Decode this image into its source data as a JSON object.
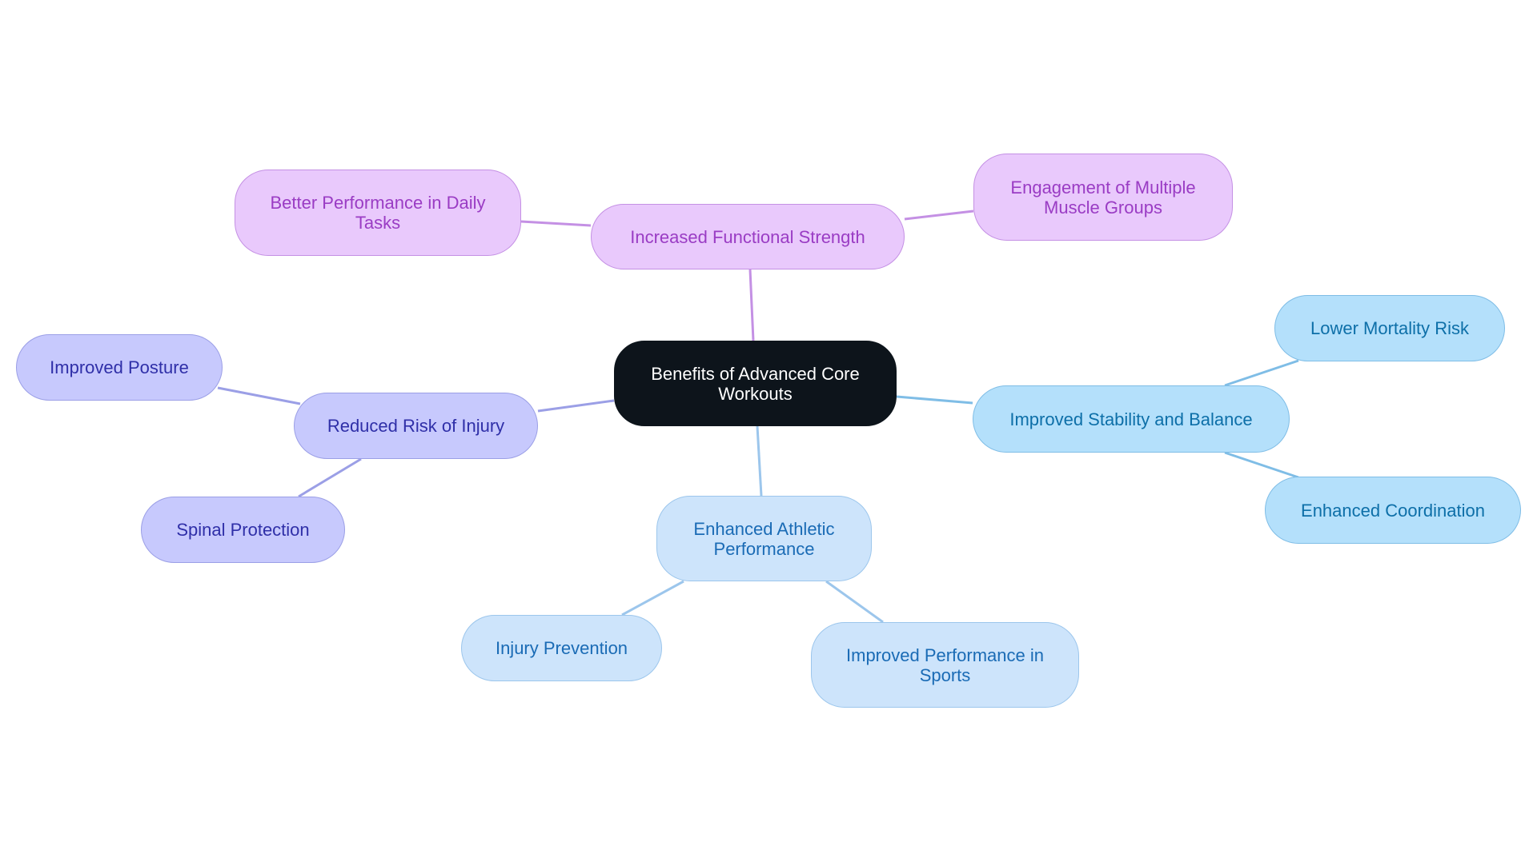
{
  "diagram": {
    "type": "mindmap",
    "root": "Benefits of Advanced Core Workouts",
    "colors": {
      "root_fill": "#0d141b",
      "purple_edge": "#c490e4",
      "indigo_edge": "#9b9fe6",
      "sky_edge": "#7fbde6",
      "pale_edge": "#9cc6ec"
    },
    "branches": [
      {
        "label": "Increased Functional Strength",
        "children": [
          "Better Performance in Daily Tasks",
          "Engagement of Multiple Muscle Groups"
        ]
      },
      {
        "label": "Improved Stability and Balance",
        "children": [
          "Lower Mortality Risk",
          "Enhanced Coordination"
        ]
      },
      {
        "label": "Reduced Risk of Injury",
        "children": [
          "Improved Posture",
          "Spinal Protection"
        ]
      },
      {
        "label": "Enhanced Athletic Performance",
        "children": [
          "Injury Prevention",
          "Improved Performance in Sports"
        ]
      }
    ]
  }
}
